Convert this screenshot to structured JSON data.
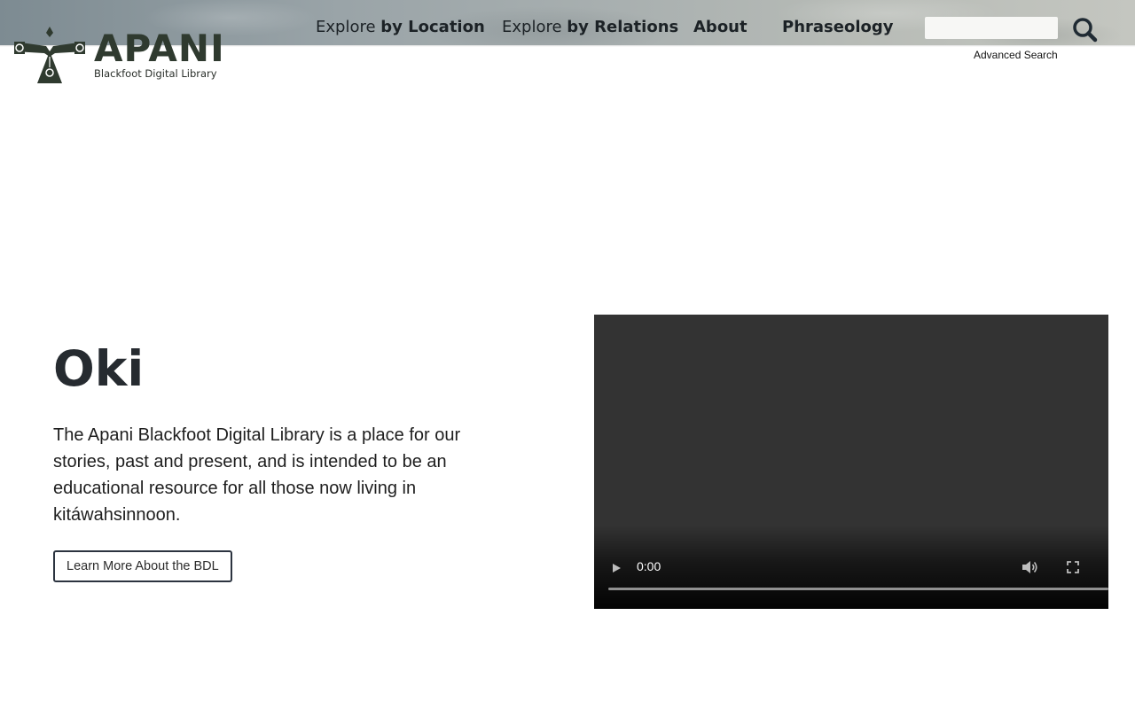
{
  "brand": {
    "name": "APANI",
    "subtitle": "Blackfoot Digital Library",
    "logo_icon": "thunderbird-logo-icon",
    "color": "#2f3a2f"
  },
  "nav": {
    "items": [
      {
        "prefix": "Explore",
        "label": "by Location"
      },
      {
        "prefix": "Explore",
        "label": "by Relations"
      },
      {
        "prefix": "",
        "label": "About"
      },
      {
        "prefix": "",
        "label": "Phraseology"
      }
    ]
  },
  "search": {
    "value": "",
    "placeholder": "",
    "button_icon": "search-icon",
    "advanced_label": "Advanced Search"
  },
  "hero": {
    "title": "Oki",
    "text": "The Apani Blackfoot Digital Library is a place for our stories, past and present, and is intended to be an educational resource for all those now living in kitáwahsinnoon.",
    "button_label": "Learn More About the BDL"
  },
  "video": {
    "time": "0:00",
    "progress": 0,
    "icons": [
      "play-icon",
      "volume-icon",
      "fullscreen-icon"
    ]
  },
  "colors": {
    "header_accent": "#8b969b",
    "button_border": "#2c3440",
    "video_bg": "#333333"
  }
}
